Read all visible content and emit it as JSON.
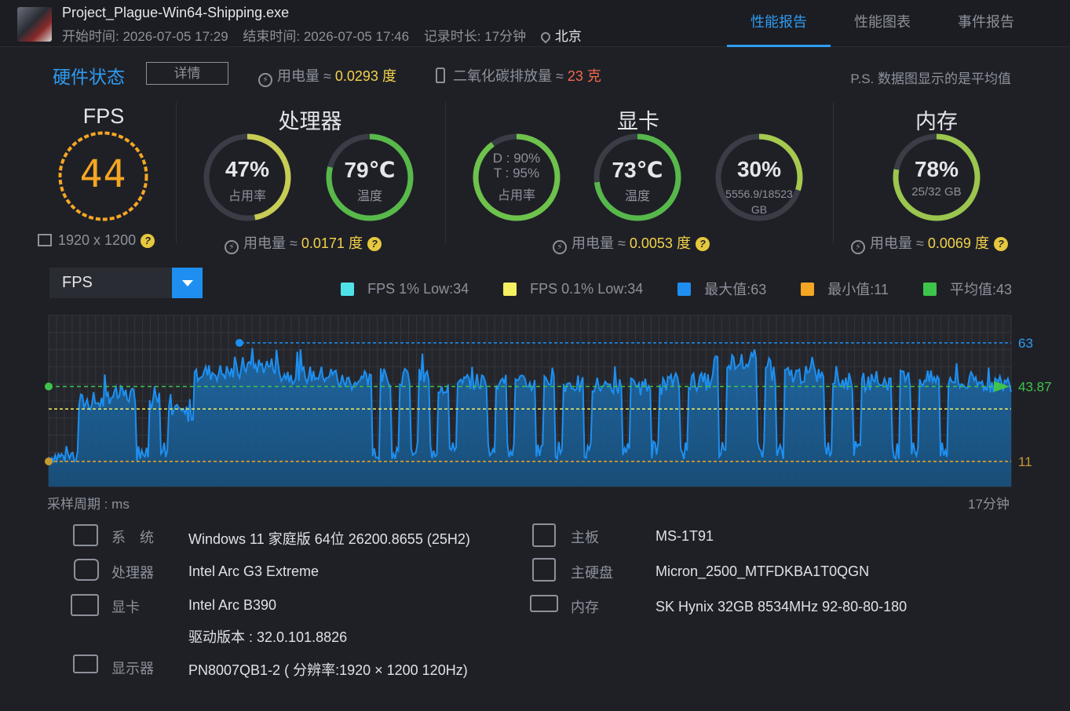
{
  "header": {
    "app_title": "Project_Plague-Win64-Shipping.exe",
    "start_time": "开始时间: 2026-07-05 17:29",
    "end_time": "结束时间: 2026-07-05 17:46",
    "duration": "记录时长: 17分钟",
    "city": "北京",
    "tabs": [
      {
        "label": "性能报告",
        "active": true
      },
      {
        "label": "性能图表",
        "active": false
      },
      {
        "label": "事件报告",
        "active": false
      }
    ]
  },
  "hardware": {
    "title": "硬件状态",
    "detail_button": "详情",
    "power_label": "用电量 ≈ ",
    "power_value": "0.0293 度",
    "co2_label": "二氧化碳排放量 ≈ ",
    "co2_value": "23 克",
    "note": "P.S. 数据图显示的是平均值"
  },
  "stats": {
    "fps": {
      "title": "FPS",
      "value": "44",
      "resolution": "1920 x 1200"
    },
    "cpu": {
      "title": "处理器",
      "usage": {
        "value": "47%",
        "label": "占用率",
        "fraction": 0.47
      },
      "temp": {
        "value": "79℃",
        "label": "温度",
        "fraction": 0.79
      },
      "power_label": "用电量 ≈ ",
      "power_value": "0.0171 度"
    },
    "gpu": {
      "title": "显卡",
      "usage": {
        "line1": "D : 90%",
        "line2": "T : 95%",
        "label": "占用率",
        "fraction": 0.9
      },
      "temp": {
        "value": "73℃",
        "label": "温度",
        "fraction": 0.73
      },
      "vram": {
        "value": "30%",
        "line1": "5556.9/18523",
        "line2": "GB",
        "fraction": 0.3
      },
      "power_label": "用电量 ≈ ",
      "power_value": "0.0053 度"
    },
    "mem": {
      "title": "内存",
      "usage": {
        "value": "78%",
        "label": "25/32 GB",
        "fraction": 0.78
      },
      "power_label": "用电量 ≈ ",
      "power_value": "0.0069 度"
    },
    "help_glyph": "?"
  },
  "chart_select": {
    "value": "FPS"
  },
  "legend": [
    {
      "label": "FPS 1% Low:34",
      "color": "#4fe3e8"
    },
    {
      "label": "FPS 0.1% Low:34",
      "color": "#f4f060"
    },
    {
      "label": "最大值:63",
      "color": "#1e8ff0"
    },
    {
      "label": "最小值:11",
      "color": "#f5a623"
    },
    {
      "label": "平均值:43",
      "color": "#3ec44b"
    }
  ],
  "chart_data": {
    "type": "area",
    "xlabel": "采样周期 : ms",
    "x_end_label": "17分钟",
    "ylim": [
      0,
      75
    ],
    "max_line": {
      "value": 63,
      "label": "63"
    },
    "avg_line": {
      "value": 43.87,
      "label": "43.87"
    },
    "low_line": {
      "value": 34
    },
    "min_line": {
      "value": 11,
      "label": "11"
    },
    "series_color": "#1e8ff0",
    "segments": [
      {
        "t": [
          0.0,
          0.03
        ],
        "v": 13
      },
      {
        "t": [
          0.03,
          0.06
        ],
        "v": 37
      },
      {
        "t": [
          0.06,
          0.09
        ],
        "v": 40
      },
      {
        "t": [
          0.09,
          0.1
        ],
        "v": 15
      },
      {
        "t": [
          0.1,
          0.12
        ],
        "v": 38
      },
      {
        "t": [
          0.12,
          0.15
        ],
        "v": 32
      },
      {
        "t": [
          0.15,
          0.2
        ],
        "v": 50
      },
      {
        "t": [
          0.2,
          0.24
        ],
        "v": 53
      },
      {
        "t": [
          0.24,
          0.3
        ],
        "v": 49
      },
      {
        "t": [
          0.3,
          0.34
        ],
        "v": 46
      },
      {
        "t": [
          0.34,
          0.4
        ],
        "v": 48
      },
      {
        "t": [
          0.4,
          0.43
        ],
        "v": 44
      },
      {
        "t": [
          0.43,
          0.48
        ],
        "v": 46
      },
      {
        "t": [
          0.48,
          0.55
        ],
        "v": 45
      },
      {
        "t": [
          0.55,
          0.64
        ],
        "v": 44
      },
      {
        "t": [
          0.64,
          0.69
        ],
        "v": 46
      },
      {
        "t": [
          0.69,
          0.75
        ],
        "v": 55
      },
      {
        "t": [
          0.75,
          0.82
        ],
        "v": 49
      },
      {
        "t": [
          0.82,
          0.88
        ],
        "v": 46
      },
      {
        "t": [
          0.88,
          0.94
        ],
        "v": 47
      },
      {
        "t": [
          0.94,
          1.0
        ],
        "v": 45
      }
    ],
    "dips": [
      0.1,
      0.12,
      0.34,
      0.36,
      0.38,
      0.4,
      0.42,
      0.46,
      0.48,
      0.51,
      0.53,
      0.56,
      0.6,
      0.63,
      0.66,
      0.7,
      0.74,
      0.76,
      0.81,
      0.84,
      0.88,
      0.9,
      0.93
    ]
  },
  "system": {
    "rows": [
      {
        "icon": "windows-icon",
        "label": "系　统",
        "value": "Windows 11 家庭版 64位 26200.8655 (25H2)"
      },
      {
        "icon": "cpu-icon",
        "label": "处理器",
        "value": "Intel Arc G3 Extreme"
      },
      {
        "icon": "gpu-icon",
        "label": "显卡",
        "value": "Intel Arc B390",
        "value2": "驱动版本 : 32.0.101.8826"
      },
      {
        "icon": "monitor-icon",
        "label": "显示器",
        "value": "PN8007QB1-2 ( 分辨率:1920 × 1200 120Hz)"
      }
    ],
    "rows_right": [
      {
        "icon": "motherboard-icon",
        "label": "主板",
        "value": "MS-1T91"
      },
      {
        "icon": "disk-icon",
        "label": "主硬盘",
        "value": "Micron_2500_MTFDKBA1T0QGN"
      },
      {
        "icon": "memory-icon",
        "label": "内存",
        "value": "SK Hynix 32GB 8534MHz 92-80-80-180"
      }
    ]
  }
}
